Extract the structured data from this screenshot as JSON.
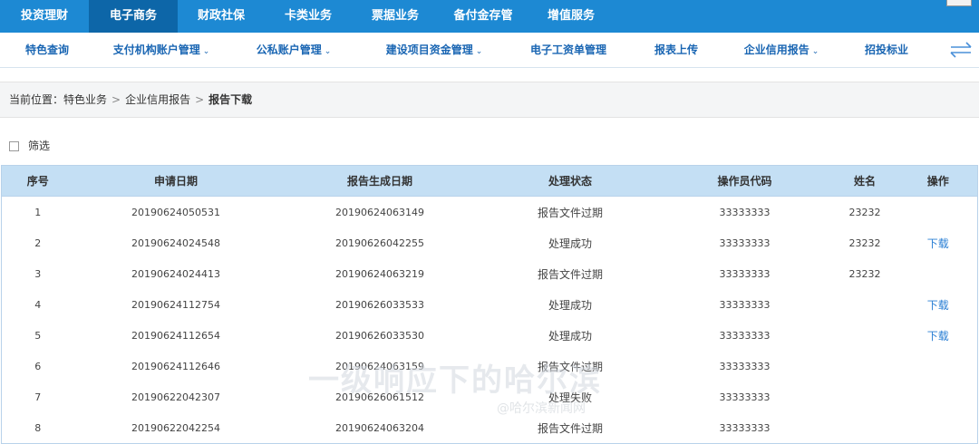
{
  "top_tabs": [
    "投资理财",
    "电子商务",
    "财政社保",
    "卡类业务",
    "票据业务",
    "备付金存管",
    "增值服务"
  ],
  "sub_nav": [
    {
      "label": "特色查询",
      "dropdown": false
    },
    {
      "label": "支付机构账户管理",
      "dropdown": true
    },
    {
      "label": "公私账户管理",
      "dropdown": true
    },
    {
      "label": "建设项目资金管理",
      "dropdown": true
    },
    {
      "label": "电子工资单管理",
      "dropdown": false
    },
    {
      "label": "报表上传",
      "dropdown": false
    },
    {
      "label": "企业信用报告",
      "dropdown": true
    },
    {
      "label": "招投标业",
      "dropdown": false
    }
  ],
  "breadcrumb": {
    "prefix": "当前位置：",
    "items": [
      "特色业务",
      "企业信用报告"
    ],
    "current": "报告下载"
  },
  "filter": {
    "label": "筛选"
  },
  "table": {
    "headers": [
      "序号",
      "申请日期",
      "报告生成日期",
      "处理状态",
      "操作员代码",
      "姓名",
      "操作"
    ],
    "rows": [
      [
        "1",
        "20190624050531",
        "20190624063149",
        "报告文件过期",
        "33333333",
        "23232",
        ""
      ],
      [
        "2",
        "20190624024548",
        "20190626042255",
        "处理成功",
        "33333333",
        "23232",
        "下载"
      ],
      [
        "3",
        "20190624024413",
        "20190624063219",
        "报告文件过期",
        "33333333",
        "23232",
        ""
      ],
      [
        "4",
        "20190624112754",
        "20190626033533",
        "处理成功",
        "33333333",
        "",
        "下载"
      ],
      [
        "5",
        "20190624112654",
        "20190626033530",
        "处理成功",
        "33333333",
        "",
        "下载"
      ],
      [
        "6",
        "20190624112646",
        "20190624063159",
        "报告文件过期",
        "33333333",
        "",
        ""
      ],
      [
        "7",
        "20190622042307",
        "20190626061512",
        "处理失败",
        "33333333",
        "",
        ""
      ],
      [
        "8",
        "20190622042254",
        "20190624063204",
        "报告文件过期",
        "33333333",
        "",
        ""
      ]
    ]
  },
  "watermark": {
    "main": "一级响应下的哈尔滨",
    "sub": "@哈尔滨新闻网"
  },
  "colors": {
    "nav_bg": "#1d89d3",
    "nav_active": "#0d66a8",
    "header_bg": "#c4dff4",
    "link": "#2a7fd4"
  }
}
